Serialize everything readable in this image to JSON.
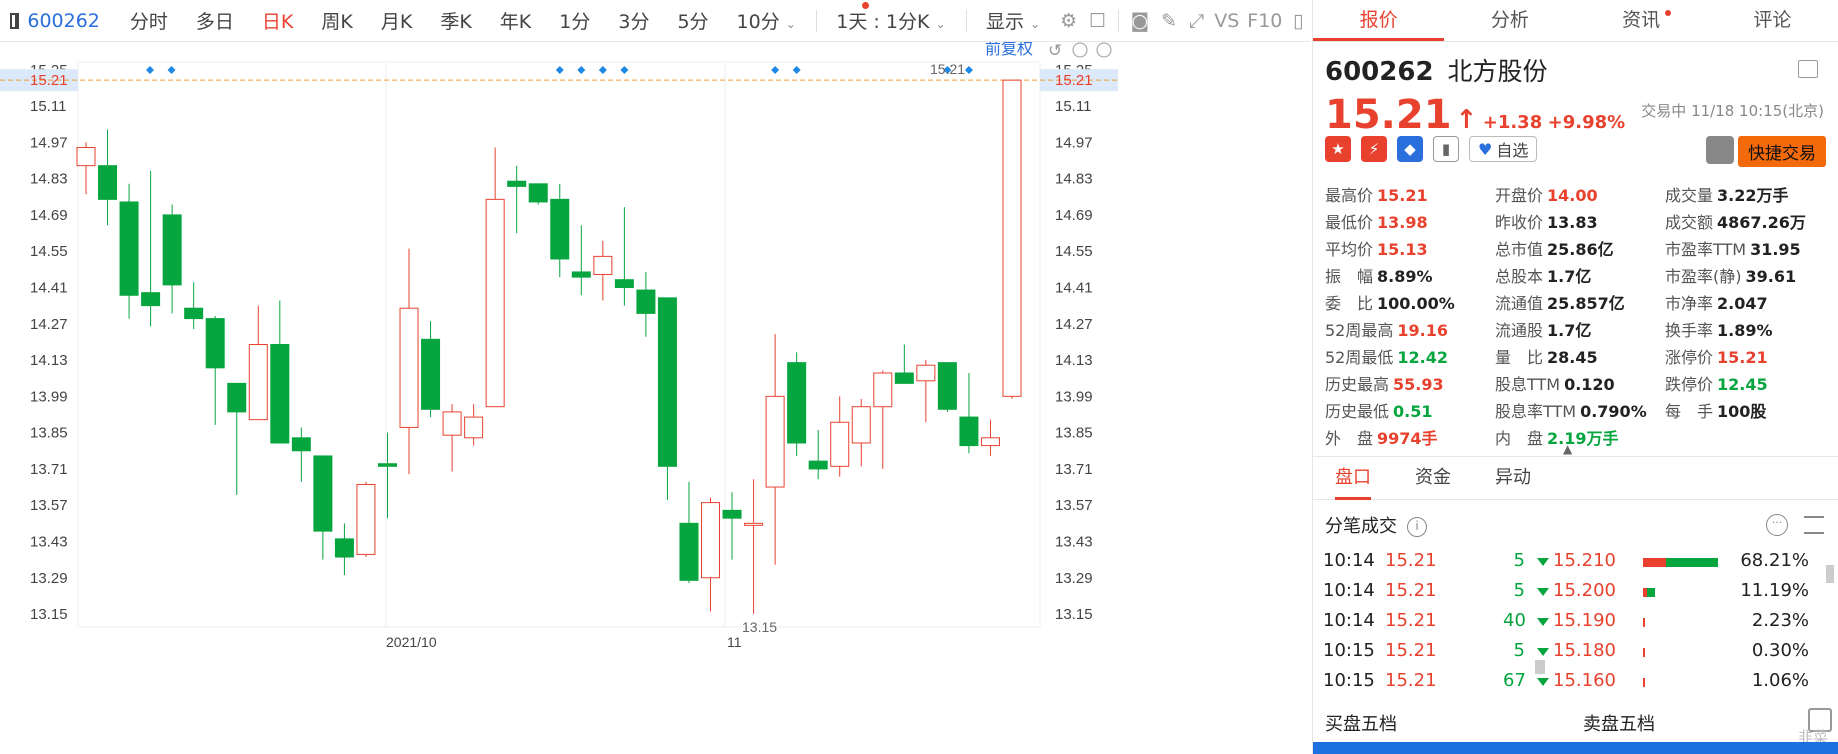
{
  "topbar": {
    "code": "600262",
    "tabs": [
      "分时",
      "多日",
      "日K",
      "周K",
      "月K",
      "季K",
      "年K",
      "1分",
      "3分",
      "5分",
      "10分"
    ],
    "active_tab": "日K",
    "tab_dropdown": "⌄",
    "multi": "1天 : 1分K",
    "display": "显示",
    "vs": "VS",
    "f10": "F10"
  },
  "chart_header": {
    "fq": "前复权"
  },
  "chart_data": {
    "type": "candlestick",
    "y_ticks": [
      15.25,
      15.21,
      15.11,
      14.97,
      14.83,
      14.69,
      14.55,
      14.41,
      14.27,
      14.13,
      13.99,
      13.85,
      13.71,
      13.57,
      13.43,
      13.29,
      13.15
    ],
    "x_labels": [
      "2021/10",
      "11"
    ],
    "current_price_label": "15.21",
    "max_label": "15.21",
    "min_label": "13.15",
    "candles": [
      {
        "o": 14.88,
        "h": 14.97,
        "l": 14.77,
        "c": 14.95
      },
      {
        "o": 14.88,
        "h": 15.02,
        "l": 14.65,
        "c": 14.75
      },
      {
        "o": 14.74,
        "h": 14.81,
        "l": 14.29,
        "c": 14.38
      },
      {
        "o": 14.39,
        "h": 14.86,
        "l": 14.26,
        "c": 14.34
      },
      {
        "o": 14.69,
        "h": 14.73,
        "l": 14.31,
        "c": 14.42
      },
      {
        "o": 14.33,
        "h": 14.43,
        "l": 14.25,
        "c": 14.29
      },
      {
        "o": 14.29,
        "h": 14.3,
        "l": 13.88,
        "c": 14.1
      },
      {
        "o": 14.04,
        "h": 14.04,
        "l": 13.61,
        "c": 13.93
      },
      {
        "o": 13.9,
        "h": 14.34,
        "l": 13.9,
        "c": 14.19
      },
      {
        "o": 14.19,
        "h": 14.36,
        "l": 13.81,
        "c": 13.81
      },
      {
        "o": 13.83,
        "h": 13.87,
        "l": 13.66,
        "c": 13.78
      },
      {
        "o": 13.76,
        "h": 13.76,
        "l": 13.36,
        "c": 13.47
      },
      {
        "o": 13.44,
        "h": 13.5,
        "l": 13.3,
        "c": 13.37
      },
      {
        "o": 13.38,
        "h": 13.66,
        "l": 13.37,
        "c": 13.65
      },
      {
        "o": 13.73,
        "h": 13.85,
        "l": 13.52,
        "c": 13.72
      },
      {
        "o": 13.87,
        "h": 14.56,
        "l": 13.69,
        "c": 14.33
      },
      {
        "o": 14.21,
        "h": 14.28,
        "l": 13.91,
        "c": 13.94
      },
      {
        "o": 13.84,
        "h": 13.96,
        "l": 13.7,
        "c": 13.93
      },
      {
        "o": 13.83,
        "h": 13.96,
        "l": 13.8,
        "c": 13.91
      },
      {
        "o": 13.95,
        "h": 14.95,
        "l": 13.95,
        "c": 14.75
      },
      {
        "o": 14.82,
        "h": 14.88,
        "l": 14.62,
        "c": 14.8
      },
      {
        "o": 14.81,
        "h": 14.8,
        "l": 14.73,
        "c": 14.74
      },
      {
        "o": 14.75,
        "h": 14.81,
        "l": 14.45,
        "c": 14.52
      },
      {
        "o": 14.47,
        "h": 14.65,
        "l": 14.38,
        "c": 14.45
      },
      {
        "o": 14.46,
        "h": 14.59,
        "l": 14.36,
        "c": 14.53
      },
      {
        "o": 14.44,
        "h": 14.72,
        "l": 14.34,
        "c": 14.41
      },
      {
        "o": 14.4,
        "h": 14.47,
        "l": 14.22,
        "c": 14.31
      },
      {
        "o": 14.37,
        "h": 14.37,
        "l": 13.59,
        "c": 13.72
      },
      {
        "o": 13.5,
        "h": 13.66,
        "l": 13.27,
        "c": 13.28
      },
      {
        "o": 13.29,
        "h": 13.6,
        "l": 13.16,
        "c": 13.58
      },
      {
        "o": 13.55,
        "h": 13.62,
        "l": 13.36,
        "c": 13.52
      },
      {
        "o": 13.5,
        "h": 13.67,
        "l": 13.15,
        "c": 13.5
      },
      {
        "o": 13.64,
        "h": 14.23,
        "l": 13.34,
        "c": 13.99
      },
      {
        "o": 14.12,
        "h": 14.16,
        "l": 13.76,
        "c": 13.81
      },
      {
        "o": 13.74,
        "h": 13.86,
        "l": 13.67,
        "c": 13.71
      },
      {
        "o": 13.72,
        "h": 13.99,
        "l": 13.68,
        "c": 13.89
      },
      {
        "o": 13.81,
        "h": 13.98,
        "l": 13.72,
        "c": 13.95
      },
      {
        "o": 13.95,
        "h": 14.09,
        "l": 13.71,
        "c": 14.08
      },
      {
        "o": 14.08,
        "h": 14.19,
        "l": 14.04,
        "c": 14.04
      },
      {
        "o": 14.05,
        "h": 14.13,
        "l": 13.89,
        "c": 14.11
      },
      {
        "o": 14.12,
        "h": 14.12,
        "l": 13.93,
        "c": 13.94
      },
      {
        "o": 13.91,
        "h": 14.08,
        "l": 13.77,
        "c": 13.8
      },
      {
        "o": 13.8,
        "h": 13.9,
        "l": 13.76,
        "c": 13.83
      },
      {
        "o": 13.99,
        "h": 15.21,
        "l": 13.98,
        "c": 15.21
      }
    ],
    "markers_top": [
      0,
      1,
      22,
      23,
      24,
      25,
      32,
      33,
      40,
      41
    ],
    "colors": {
      "up": "#e8422f",
      "down": "#06a53f",
      "grid": "#eeeeee",
      "price_line": "#f0a030"
    }
  },
  "right": {
    "tabs": [
      "报价",
      "分析",
      "资讯",
      "评论"
    ],
    "code": "600262",
    "name": "北方股份",
    "price": "15.21",
    "arrow": "↑",
    "change": "+1.38",
    "change_pct": "+9.98%",
    "status": "交易中 11/18 10:15(北京)",
    "zixuan": "自选",
    "quick_trade": "快捷交易",
    "stats": [
      [
        [
          "最高价",
          "15.21",
          "r"
        ],
        [
          "开盘价",
          "14.00",
          "r"
        ],
        [
          "成交量",
          "3.22万手",
          ""
        ]
      ],
      [
        [
          "最低价",
          "13.98",
          "r"
        ],
        [
          "昨收价",
          "13.83",
          ""
        ],
        [
          "成交额",
          "4867.26万",
          ""
        ]
      ],
      [
        [
          "平均价",
          "15.13",
          "r"
        ],
        [
          "总市值",
          "25.86亿",
          ""
        ],
        [
          "市盈率TTM",
          "31.95",
          ""
        ]
      ],
      [
        [
          "振　幅",
          "8.89%",
          ""
        ],
        [
          "总股本",
          "1.7亿",
          ""
        ],
        [
          "市盈率(静)",
          "39.61",
          ""
        ]
      ],
      [
        [
          "委　比",
          "100.00%",
          ""
        ],
        [
          "流通值",
          "25.857亿",
          ""
        ],
        [
          "市净率",
          "2.047",
          ""
        ]
      ],
      [
        [
          "52周最高",
          "19.16",
          "r"
        ],
        [
          "流通股",
          "1.7亿",
          ""
        ],
        [
          "换手率",
          "1.89%",
          ""
        ]
      ],
      [
        [
          "52周最低",
          "12.42",
          "g"
        ],
        [
          "量　比",
          "28.45",
          ""
        ],
        [
          "涨停价",
          "15.21",
          "r"
        ]
      ],
      [
        [
          "历史最高",
          "55.93",
          "r"
        ],
        [
          "股息TTM",
          "0.120",
          ""
        ],
        [
          "跌停价",
          "12.45",
          "g"
        ]
      ],
      [
        [
          "历史最低",
          "0.51",
          "g"
        ],
        [
          "股息率TTM",
          "0.790%",
          ""
        ],
        [
          "每　手",
          "100股",
          ""
        ]
      ],
      [
        [
          "外　盘",
          "9974手",
          "r"
        ],
        [
          "内　盘",
          "2.19万手",
          "g"
        ],
        [
          "",
          ""
        ]
      ]
    ],
    "panel_tabs": [
      "盘口",
      "资金",
      "异动"
    ],
    "trades_title": "分笔成交",
    "trades": [
      {
        "t": "10:14",
        "p": "15.21",
        "q": "5"
      },
      {
        "t": "10:14",
        "p": "15.21",
        "q": "5"
      },
      {
        "t": "10:14",
        "p": "15.21",
        "q": "40"
      },
      {
        "t": "10:15",
        "p": "15.21",
        "q": "5"
      },
      {
        "t": "10:15",
        "p": "15.21",
        "q": "67"
      }
    ],
    "dist": [
      {
        "p": "15.210",
        "pct": "68.21%",
        "frac": 0.6821
      },
      {
        "p": "15.200",
        "pct": "11.19%",
        "frac": 0.1119
      },
      {
        "p": "15.190",
        "pct": "2.23%",
        "frac": 0.0223
      },
      {
        "p": "15.180",
        "pct": "0.30%",
        "frac": 0.003
      },
      {
        "p": "15.160",
        "pct": "1.06%",
        "frac": 0.0106
      }
    ],
    "buy5": "买盘五档",
    "sell5": "卖盘五档",
    "watermark": "韭菜"
  }
}
